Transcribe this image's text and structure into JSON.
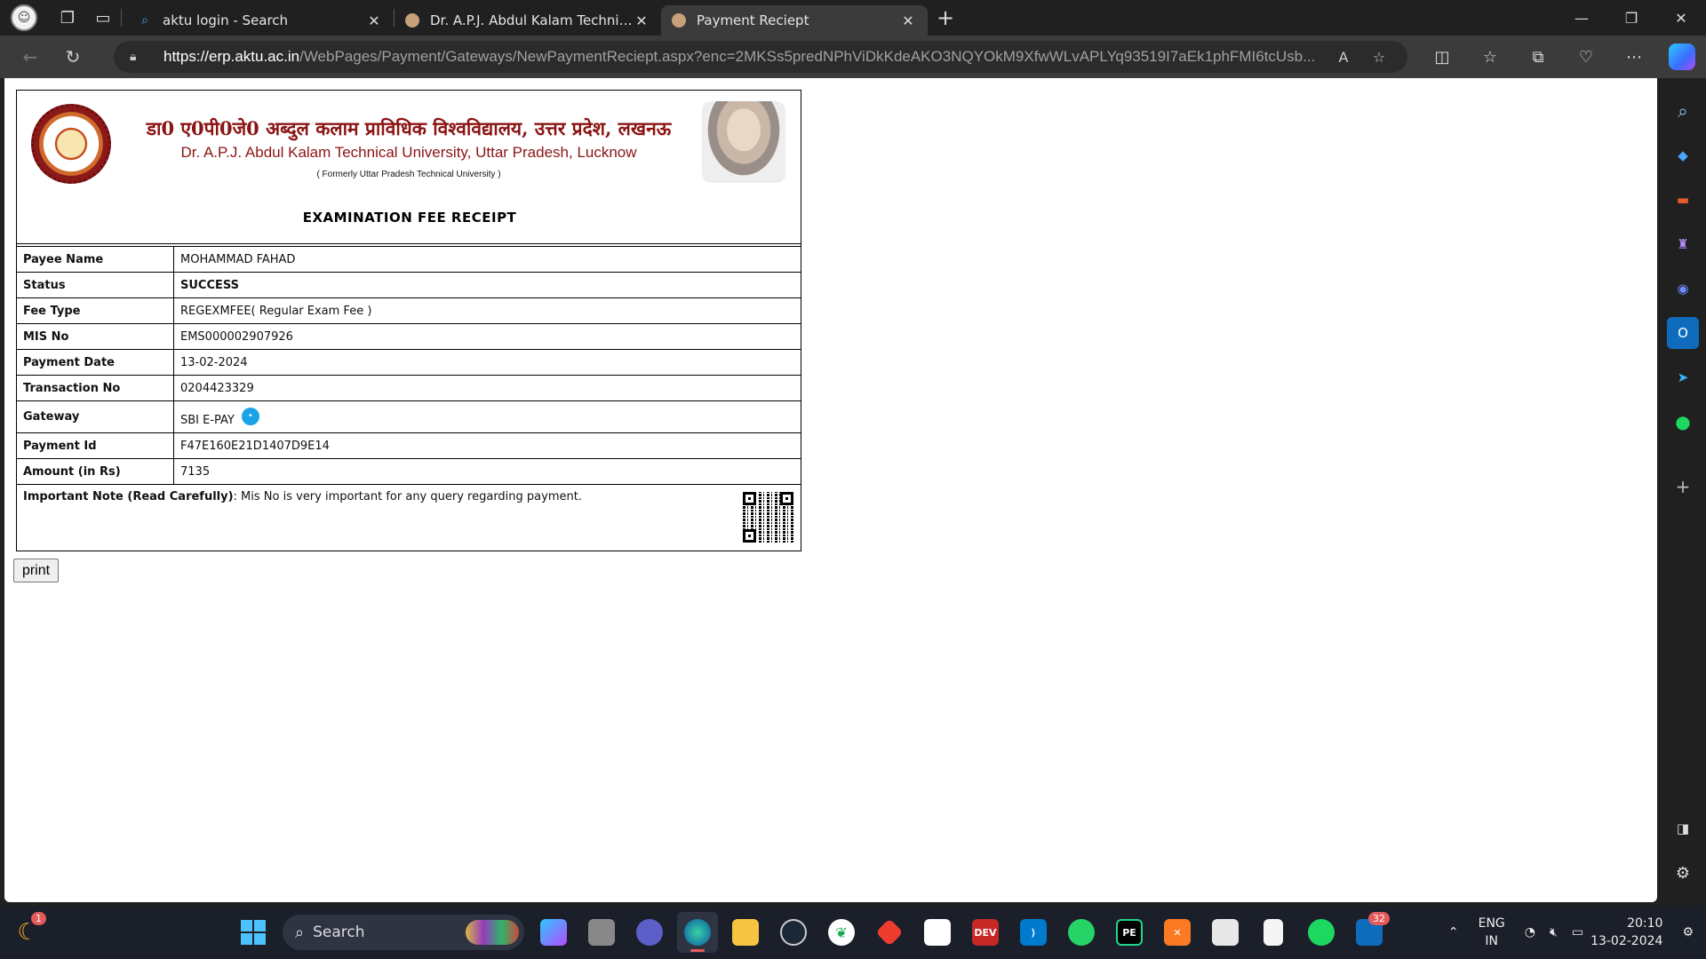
{
  "browser": {
    "tabs": [
      {
        "title": "aktu login - Search",
        "fav": "search-icon",
        "active": false
      },
      {
        "title": "Dr. A.P.J. Abdul Kalam Technical U",
        "fav": "aktu-favicon",
        "active": false
      },
      {
        "title": "Payment Reciept",
        "fav": "aktu-favicon",
        "active": true
      }
    ],
    "url_host": "https://erp.aktu.ac.in",
    "url_path": "/WebPages/Payment/Gateways/NewPaymentReciept.aspx?enc=2MKSs5predNPhViDkKdeAKO3NQYOkM9XfwWLvAPLYq93519I7aEk1phFMI6tcUsb..."
  },
  "receipt": {
    "hindi_title": "डा0 ए0पी0जे0 अब्दुल कलाम प्राविधिक विश्वविद्यालय, उत्तर प्रदेश, लखनऊ",
    "english_title": "Dr. A.P.J. Abdul Kalam Technical University, Uttar Pradesh, Lucknow",
    "formerly": "( Formerly Uttar Pradesh Technical University )",
    "heading": "EXAMINATION FEE RECEIPT",
    "rows": [
      {
        "label": "Payee Name",
        "value": "MOHAMMAD FAHAD"
      },
      {
        "label": "Status",
        "value": "SUCCESS"
      },
      {
        "label": "Fee Type",
        "value": "REGEXMFEE( Regular Exam Fee )"
      },
      {
        "label": "MIS No",
        "value": "EMS000002907926"
      },
      {
        "label": "Payment Date",
        "value": "13-02-2024"
      },
      {
        "label": "Transaction No",
        "value": "0204423329"
      },
      {
        "label": "Gateway",
        "value": "SBI E-PAY"
      },
      {
        "label": "Payment Id",
        "value": "F47E160E21D1407D9E14"
      },
      {
        "label": "Amount (in Rs)",
        "value": "7135"
      }
    ],
    "note_label": "Important Note (Read Carefully)",
    "note_text": ": Mis No is very important for any query regarding payment.",
    "print_label": "print"
  },
  "taskbar": {
    "search_placeholder": "Search",
    "weather_badge": "1",
    "mail_badge": "32",
    "lang_top": "ENG",
    "lang_bottom": "IN",
    "time": "20:10",
    "date": "13-02-2024"
  }
}
